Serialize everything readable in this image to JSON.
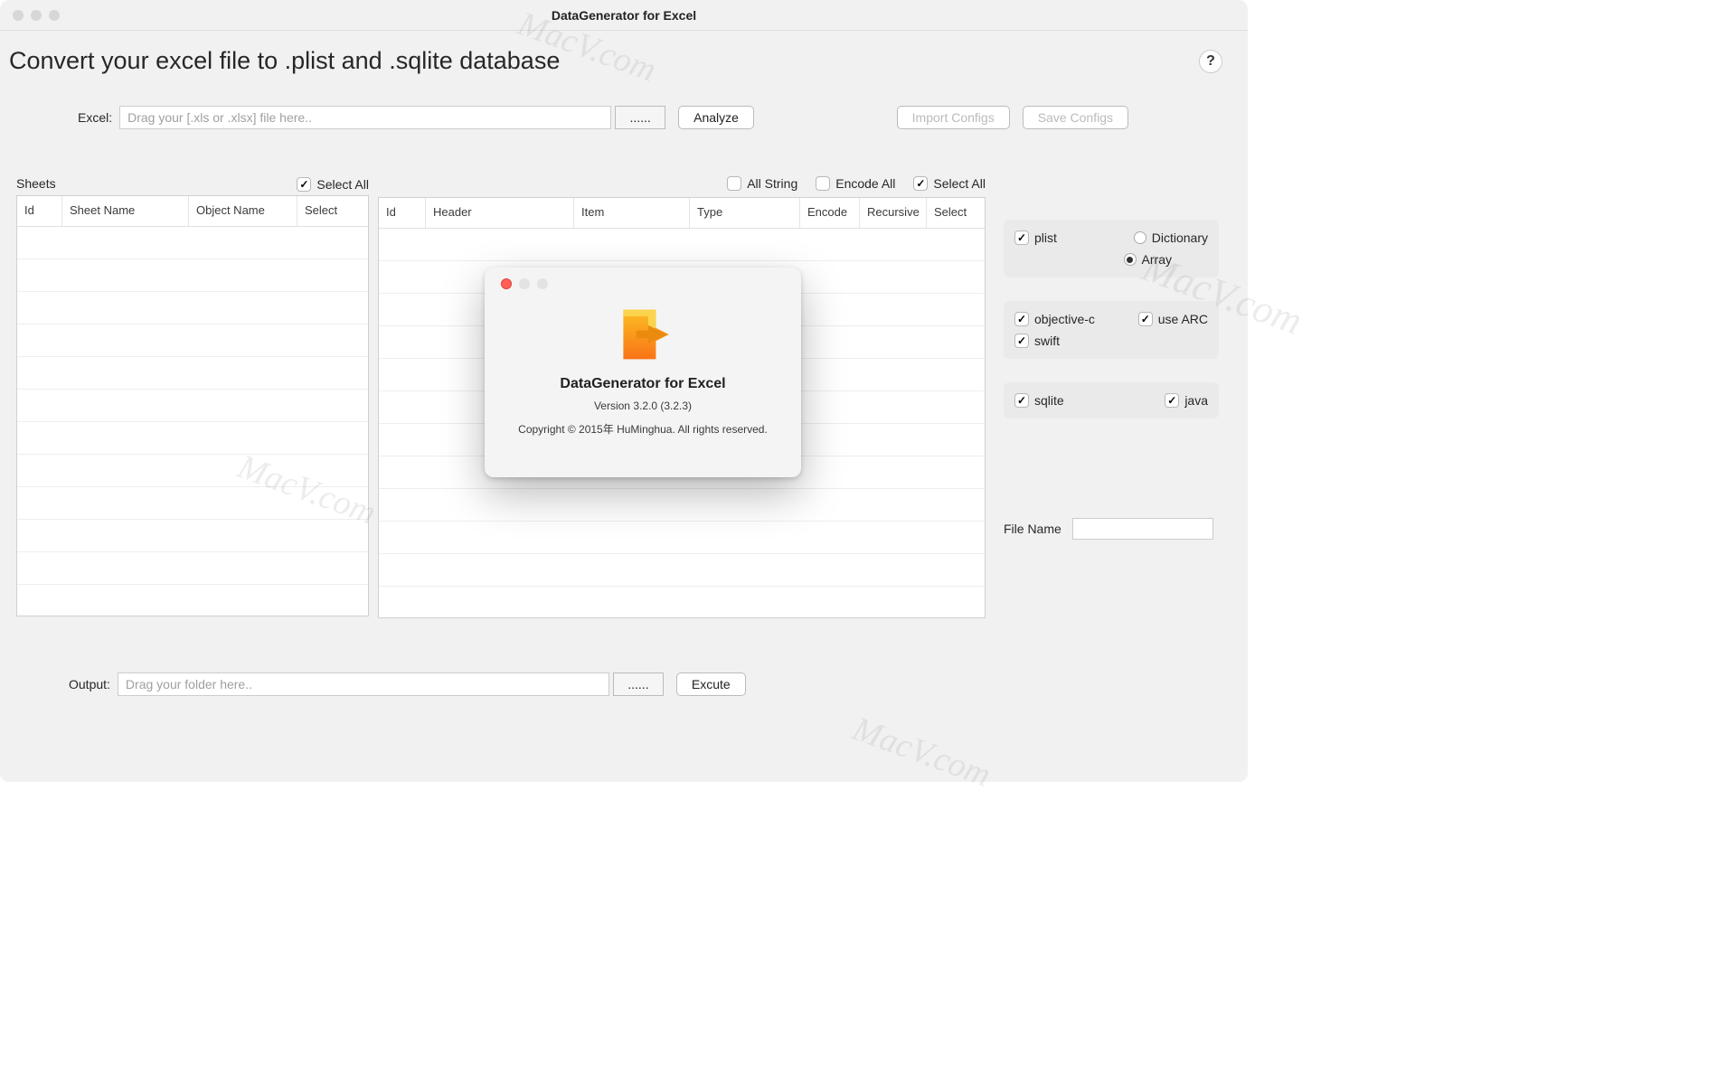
{
  "window": {
    "title": "DataGenerator for Excel",
    "heading": "Convert your excel file to .plist and .sqlite database",
    "help_glyph": "?"
  },
  "excel": {
    "label": "Excel:",
    "placeholder": "Drag your [.xls or .xlsx] file here..",
    "browse": "......",
    "analyze": "Analyze",
    "import_configs": "Import Configs",
    "save_configs": "Save Configs"
  },
  "sheets": {
    "title": "Sheets",
    "select_all": "Select All",
    "columns": {
      "id": "Id",
      "sheet_name": "Sheet Name",
      "object_name": "Object Name",
      "select": "Select"
    }
  },
  "fields": {
    "all_string": "All String",
    "encode_all": "Encode All",
    "select_all": "Select All",
    "columns": {
      "id": "Id",
      "header": "Header",
      "item": "Item",
      "type": "Type",
      "encode": "Encode",
      "recursive": "Recursive",
      "select": "Select"
    }
  },
  "options": {
    "plist": "plist",
    "dictionary": "Dictionary",
    "array": "Array",
    "objc": "objective-c",
    "arc": "use ARC",
    "swift": "swift",
    "sqlite": "sqlite",
    "java": "java"
  },
  "file_name": {
    "label": "File Name"
  },
  "output": {
    "label": "Output:",
    "placeholder": "Drag your folder here..",
    "browse": "......",
    "execute": "Excute"
  },
  "about": {
    "title": "DataGenerator for Excel",
    "version": "Version 3.2.0 (3.2.3)",
    "copyright": "Copyright © 2015年 HuMinghua. All rights reserved."
  },
  "watermark": "MacV.com"
}
